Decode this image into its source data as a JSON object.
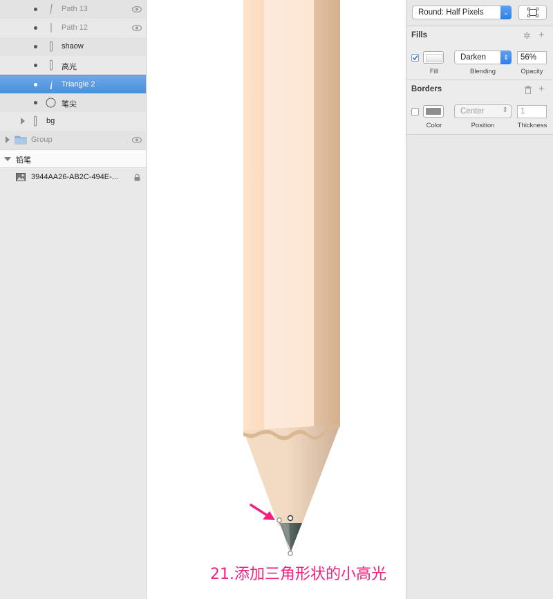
{
  "layers": {
    "items": [
      {
        "label": "Path 13",
        "dim": true,
        "visibility_icon": "eye-icon",
        "thumb": "path-icon"
      },
      {
        "label": "Path 12",
        "dim": true,
        "visibility_icon": "eye-icon",
        "thumb": "path-icon"
      },
      {
        "label": "shaow",
        "thumb": "path-icon"
      },
      {
        "label": "高光",
        "thumb": "path-icon"
      },
      {
        "label": "Triangle 2",
        "selected": true,
        "thumb": "triangle-icon"
      },
      {
        "label": "笔尖",
        "thumb": "oval-icon"
      },
      {
        "label": "bg",
        "thumb": "path-icon",
        "collapsed": true
      },
      {
        "label": "Group",
        "dim": true,
        "thumb": "folder-icon",
        "collapsed": true,
        "visibility_icon": "eye-icon"
      }
    ],
    "artboard": {
      "label": "铅笔",
      "expanded": true
    },
    "bitmap": {
      "label": "3944AA26-AB2C-494E-...",
      "thumb": "image-icon",
      "locked": true
    }
  },
  "canvas": {
    "caption": "21.添加三角形状的小高光"
  },
  "inspector": {
    "rounding": {
      "value": "Round: Half Pixels"
    },
    "fills": {
      "title": "Fills",
      "enabled": true,
      "blending": "Darken",
      "opacity": "56%",
      "labels": {
        "fill": "Fill",
        "blending": "Blending",
        "opacity": "Opacity"
      }
    },
    "borders": {
      "title": "Borders",
      "enabled": false,
      "position": "Center",
      "thickness": "1",
      "color": "#8e8e8e",
      "labels": {
        "color": "Color",
        "position": "Position",
        "thickness": "Thickness"
      }
    }
  },
  "colors": {
    "selection": "#4a8fde",
    "caption": "#f2207e",
    "pencil_light": "#fde6d2",
    "pencil_dark": "#d7b594"
  }
}
